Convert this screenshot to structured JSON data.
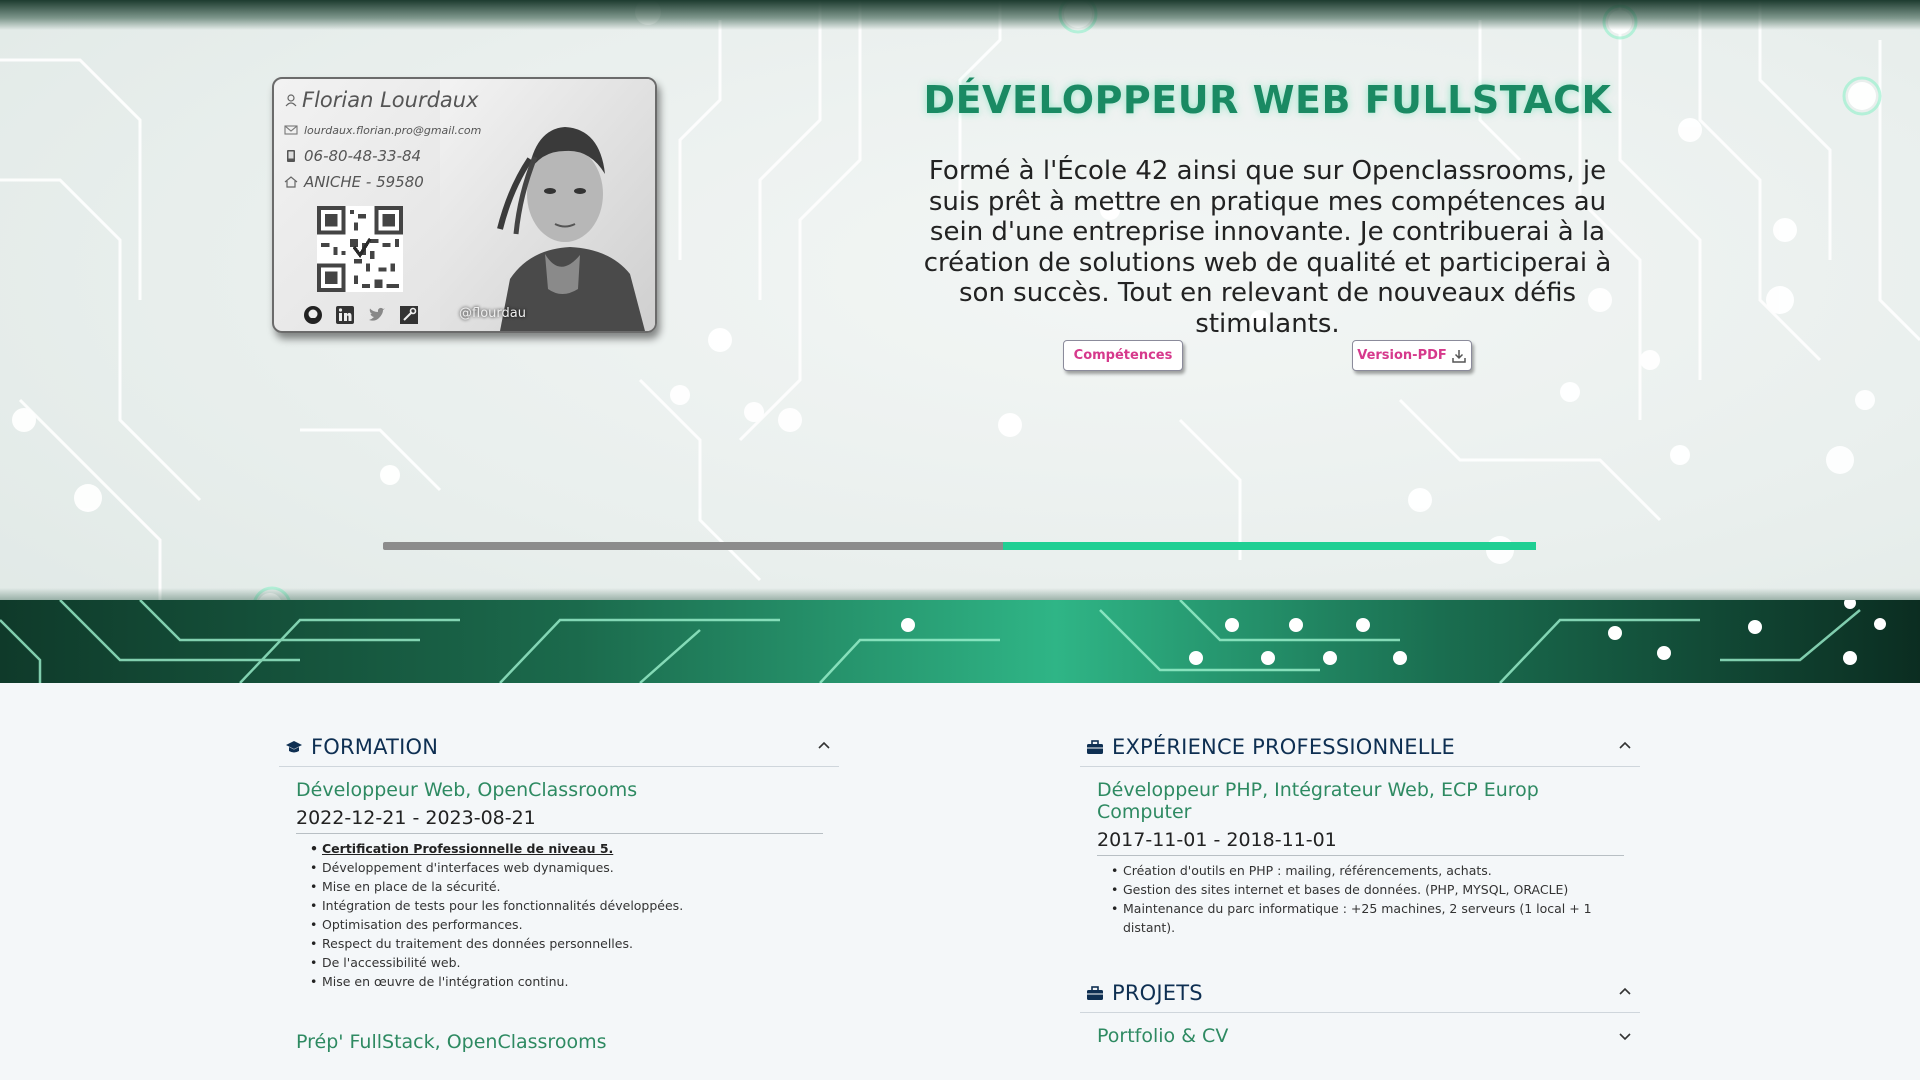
{
  "hero": {
    "card": {
      "name": "Florian Lourdaux",
      "email": "lourdaux.florian.pro@gmail.com",
      "phone": "06-80-48-33-84",
      "city": "ANICHE - 59580",
      "handle": "@flourdau",
      "socials": [
        "github-icon",
        "linkedin-icon",
        "twitter-icon",
        "tools-icon"
      ]
    },
    "title": "DÉVELOPPEUR WEB FULLSTACK",
    "description": "Formé à l'École 42 ainsi que sur Openclassrooms, je suis prêt à mettre en pratique mes compétences au sein d'une entreprise innovante. Je contribuerai à la création de solutions web de qualité et participerai à son succès. Tout en relevant de nouveaux défis stimulants.",
    "buttons": {
      "skills": "Compétences",
      "pdf": "Version-PDF"
    },
    "progress": {
      "start": 0.538,
      "end": 1.0
    },
    "colors": {
      "accent": "#1a8a63",
      "button_text": "#d6398c",
      "progress": "#1fcf93"
    }
  },
  "formation": {
    "title": "FORMATION",
    "entries": [
      {
        "title": "Développeur Web, OpenClassrooms",
        "dates": "2022-12-21 - 2023-08-21",
        "items": [
          "Certification Professionnelle de niveau 5.",
          "Développement d'interfaces web dynamiques.",
          "Mise en place de la sécurité.",
          "Intégration de tests pour les fonctionnalités développées.",
          "Optimisation des performances.",
          "Respect du traitement des données personnelles.",
          "De l'accessibilité web.",
          "Mise en œuvre de l'intégration continu."
        ]
      },
      {
        "title": "Prép' FullStack, OpenClassrooms"
      }
    ]
  },
  "experience": {
    "title": "EXPÉRIENCE PROFESSIONNELLE",
    "entries": [
      {
        "title": "Développeur PHP, Intégrateur Web, ECP Europ Computer",
        "dates": "2017-11-01 - 2018-11-01",
        "items": [
          "Création d'outils en PHP : mailing, référencements, achats.",
          "Gestion des sites internet et bases de données. (PHP, MYSQL, ORACLE)",
          "Maintenance du parc informatique : +25 machines, 2 serveurs (1 local + 1 distant)."
        ]
      }
    ]
  },
  "projets": {
    "title": "PROJETS",
    "entries": [
      {
        "title": "Portfolio & CV"
      }
    ]
  }
}
